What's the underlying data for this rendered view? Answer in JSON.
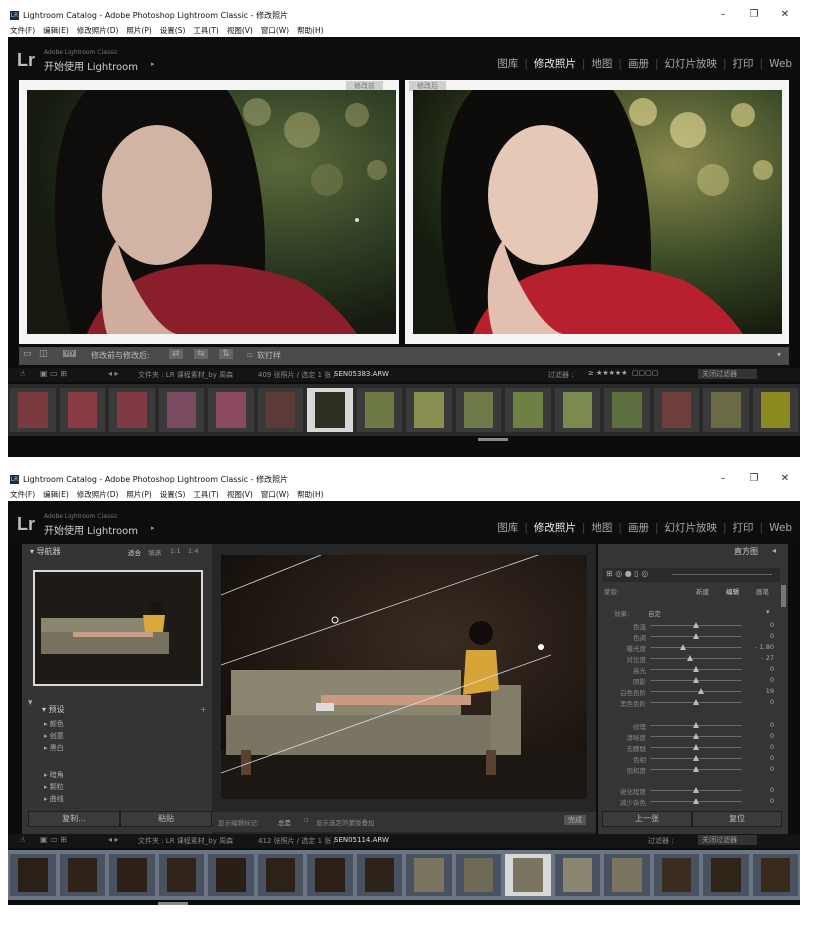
{
  "window": {
    "title": "Lightroom Catalog - Adobe Photoshop Lightroom Classic - 修改照片",
    "min": "–",
    "max": "❐",
    "close": "✕"
  },
  "menu": [
    "文件(F)",
    "编辑(E)",
    "修改照片(D)",
    "照片(P)",
    "设置(S)",
    "工具(T)",
    "视图(V)",
    "窗口(W)",
    "帮助(H)"
  ],
  "brand": {
    "logo": "Lr",
    "sub": "Adobe Lightroom Classic",
    "identity": "开始使用 Lightroom"
  },
  "modules": [
    "图库",
    "修改照片",
    "地图",
    "画册",
    "幻灯片放映",
    "打印",
    "Web"
  ],
  "active_module": "修改照片",
  "top": {
    "before_label": "修改前",
    "after_label": "修改后",
    "toolbar_label": "修改前与修改后:",
    "softproof": "软打样",
    "path_prefix": "文件夹 : LR 课程素材_by 周森",
    "count": "409 张照片 / 选定 1 张 /",
    "filename": "SEN05383.ARW",
    "filter_label": "过滤器 :",
    "filter_value": "关闭过滤器",
    "thumb_count": 16,
    "selected_thumb": 6
  },
  "bottom": {
    "navigator": "导航器",
    "zoom": [
      "适合",
      "填满",
      "1:1",
      "1:4"
    ],
    "presets": "预设",
    "preset_items": [
      "颜色",
      "创意",
      "黑白",
      "暗角",
      "颗粒",
      "曲线"
    ],
    "copy": "复制...",
    "paste": "粘贴",
    "toolbar_mask": "显示编辑标记:",
    "toolbar_auto": "总是",
    "toolbar_overlay": "显示选定的蒙版叠加",
    "done": "完成",
    "histogram": "直方图",
    "mask_label": "蒙版:",
    "mask_new": "新建",
    "mask_edit": "编辑",
    "mask_brush": "画笔",
    "effect": "效果:",
    "effect_value": "自定",
    "sliders": [
      {
        "label": "色温",
        "value": "0"
      },
      {
        "label": "色调",
        "value": "0"
      },
      {
        "label": "曝光度",
        "value": "- 1.80"
      },
      {
        "label": "对比度",
        "value": "- 27"
      },
      {
        "label": "高光",
        "value": "0"
      },
      {
        "label": "阴影",
        "value": "0"
      },
      {
        "label": "白色色阶",
        "value": "19"
      },
      {
        "label": "黑色色阶",
        "value": "0"
      },
      {
        "label": "纹理",
        "value": "0"
      },
      {
        "label": "清晰度",
        "value": "0"
      },
      {
        "label": "去朦胧",
        "value": "0"
      },
      {
        "label": "色相",
        "value": "0"
      },
      {
        "label": "饱和度",
        "value": "0"
      },
      {
        "label": "锐化程度",
        "value": "0"
      },
      {
        "label": "减少杂色",
        "value": "0"
      }
    ],
    "prev_btn": "上一张",
    "reset_btn": "复位",
    "path_prefix": "文件夹 : LR 课程素材_by 周森",
    "count": "412 张照片 / 选定 1 张 /",
    "filename": "SEN05114.ARW",
    "filter_label": "过滤器 :",
    "filter_value": "关闭过滤器",
    "thumb_count": 16,
    "selected_thumb": 10
  }
}
